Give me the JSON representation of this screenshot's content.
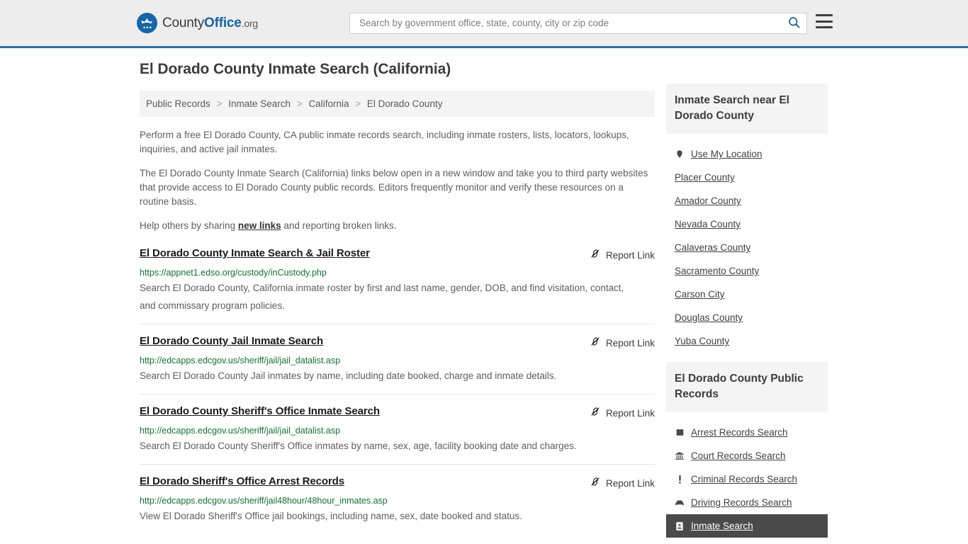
{
  "header": {
    "logo": {
      "icon": "eagle-shield-icon",
      "text_county": "County",
      "text_office": "Office",
      "text_org": ".org"
    },
    "search": {
      "placeholder": "Search by government office, state, county, city or zip code",
      "value": "",
      "search_icon": "search-icon"
    },
    "menu_icon": "hamburger-menu-icon"
  },
  "main": {
    "page_title": "El Dorado County Inmate Search (California)",
    "breadcrumb": [
      {
        "label": "Public Records"
      },
      {
        "label": "Inmate Search"
      },
      {
        "label": "California"
      },
      {
        "label": "El Dorado County"
      }
    ],
    "breadcrumb_separator": ">",
    "intro": {
      "p1": "Perform a free El Dorado County, CA public inmate records search, including inmate rosters, lists, locators, lookups, inquiries, and active jail inmates.",
      "p2": "The El Dorado County Inmate Search (California) links below open in a new window and take you to third party websites that provide access to El Dorado County public records. Editors frequently monitor and verify these resources on a routine basis.",
      "p3_before": "Help others by sharing ",
      "p3_link": "new links",
      "p3_after": " and reporting broken links."
    },
    "report_link_label": "Report Link",
    "report_link_icon": "broken-link-icon",
    "results": [
      {
        "title": "El Dorado County Inmate Search & Jail Roster",
        "url": "https://appnet1.edso.org/custody/inCustody.php",
        "description": "Search El Dorado County, California inmate roster by first and last name, gender, DOB, and find visitation, contact, and commissary program policies."
      },
      {
        "title": "El Dorado County Jail Inmate Search",
        "url": "http://edcapps.edcgov.us/sheriff/jail/jail_datalist.asp",
        "description": "Search El Dorado County Jail inmates by name, including date booked, charge and inmate details."
      },
      {
        "title": "El Dorado County Sheriff's Office Inmate Search",
        "url": "http://edcapps.edcgov.us/sheriff/jail/jail_datalist.asp",
        "description": "Search El Dorado County Sheriff's Office inmates by name, sex, age, facility booking date and charges."
      },
      {
        "title": "El Dorado Sheriff's Office Arrest Records",
        "url": "http://edcapps.edcgov.us/sheriff/jail48hour/48hour_inmates.asp",
        "description": "View El Dorado Sheriff's Office jail bookings, including name, sex, date booked and status."
      }
    ]
  },
  "sidebar": {
    "nearby": {
      "title": "Inmate Search near El Dorado County",
      "items": [
        {
          "label": "Use My Location",
          "icon": "map-pin-icon"
        },
        {
          "label": "Placer County",
          "icon": ""
        },
        {
          "label": "Amador County",
          "icon": ""
        },
        {
          "label": "Nevada County",
          "icon": ""
        },
        {
          "label": "Calaveras County",
          "icon": ""
        },
        {
          "label": "Sacramento County",
          "icon": ""
        },
        {
          "label": "Carson City",
          "icon": ""
        },
        {
          "label": "Douglas County",
          "icon": ""
        },
        {
          "label": "Yuba County",
          "icon": ""
        }
      ]
    },
    "public_records": {
      "title": "El Dorado County Public Records",
      "items": [
        {
          "label": "Arrest Records Search",
          "icon": "fingerprint-icon",
          "active": false
        },
        {
          "label": "Court Records Search",
          "icon": "courthouse-icon",
          "active": false
        },
        {
          "label": "Criminal Records Search",
          "icon": "exclamation-icon",
          "active": false
        },
        {
          "label": "Driving Records Search",
          "icon": "car-icon",
          "active": false
        },
        {
          "label": "Inmate Search",
          "icon": "id-card-icon",
          "active": true
        }
      ]
    }
  },
  "colors": {
    "brand_blue": "#1565a8",
    "header_bg": "#ededed",
    "header_border": "#2e6da4",
    "url_green": "#13722f",
    "panel_gray": "#f4f4f4",
    "active_dark": "#4a4a4a"
  }
}
